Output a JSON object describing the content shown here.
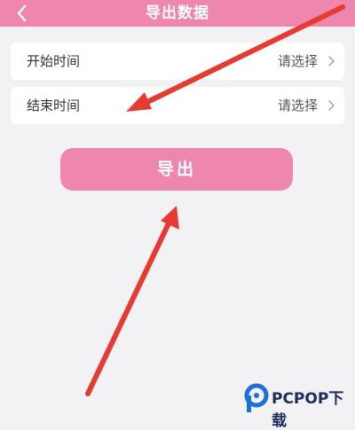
{
  "header": {
    "title": "导出数据",
    "back_icon": "chevron-left-icon"
  },
  "form": {
    "start_time": {
      "label": "开始时间",
      "value": "请选择"
    },
    "end_time": {
      "label": "结束时间",
      "value": "请选择"
    }
  },
  "actions": {
    "export_label": "导出"
  },
  "watermark": {
    "brand": "PCPOP下载"
  },
  "colors": {
    "accent": "#ee86ad",
    "arrow": "#e53b32",
    "background": "#f2f2f4"
  }
}
